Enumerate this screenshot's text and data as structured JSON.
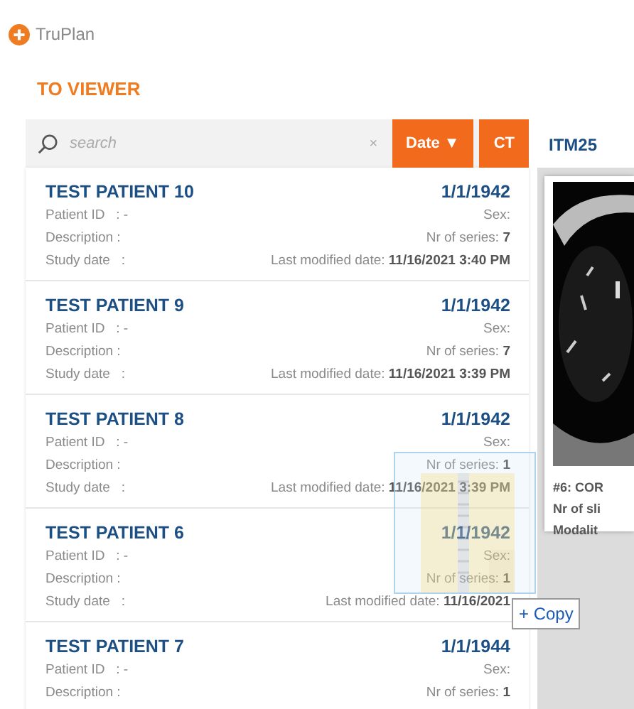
{
  "app": {
    "name": "TruPlan"
  },
  "section_title": "TO VIEWER",
  "search": {
    "placeholder": "search",
    "clear": "×"
  },
  "filters": [
    {
      "label": "Date ▼"
    },
    {
      "label": "CT"
    }
  ],
  "patients": [
    {
      "name": "TEST PATIENT 10",
      "dob": "1/1/1942",
      "rows": [
        {
          "left": "Patient ID   : -",
          "right": "Sex:"
        },
        {
          "left": "Description :",
          "right": "Nr of series: **7**"
        },
        {
          "left": "Study date   :",
          "right": "Last modified date: **11/16/2021 3:40 PM**"
        }
      ]
    },
    {
      "name": "TEST PATIENT 9",
      "dob": "1/1/1942",
      "rows": [
        {
          "left": "Patient ID   : -",
          "right": "Sex:"
        },
        {
          "left": "Description :",
          "right": "Nr of series: **7**"
        },
        {
          "left": "Study date   :",
          "right": "Last modified date: **11/16/2021 3:39 PM**"
        }
      ]
    },
    {
      "name": "TEST PATIENT 8",
      "dob": "1/1/1942",
      "rows": [
        {
          "left": "Patient ID   : -",
          "right": "Sex:"
        },
        {
          "left": "Description :",
          "right": "Nr of series: **1**"
        },
        {
          "left": "Study date   :",
          "right": "Last modified date: **11/16/2021 3:39 PM**"
        }
      ]
    },
    {
      "name": "TEST PATIENT 6",
      "dob": "1/1/1942",
      "rows": [
        {
          "left": "Patient ID   : -",
          "right": "Sex:"
        },
        {
          "left": "Description :",
          "right": "Nr of series: **1**"
        },
        {
          "left": "Study date   :",
          "right": "Last modified date: **11/16/2021**"
        }
      ]
    },
    {
      "name": "TEST PATIENT 7",
      "dob": "1/1/1944",
      "rows": [
        {
          "left": "Patient ID   : -",
          "right": "Sex:"
        },
        {
          "left": "Description :",
          "right": "Nr of series: **1**"
        }
      ]
    }
  ],
  "study": {
    "title": "ITM25",
    "caption": [
      "#6: COR",
      "Nr of sli",
      "Modalit"
    ]
  },
  "drag": {
    "label": "+ Copy"
  }
}
